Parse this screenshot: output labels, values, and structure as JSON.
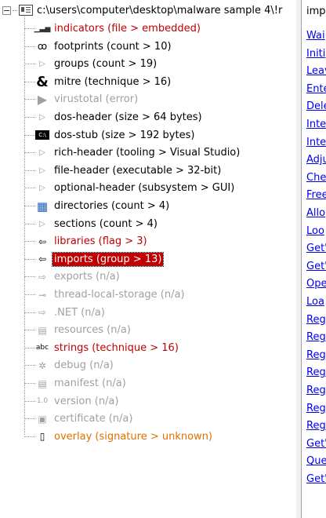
{
  "tree": {
    "root_label": "c:\\users\\computer\\desktop\\malware sample 4\\!r",
    "items": [
      {
        "label": "indicators (file > embedded)",
        "icon": "bar-chart-icon",
        "glyph": "▁▃▅",
        "color": "red"
      },
      {
        "label": "footprints (count > 10)",
        "icon": "footprints-icon",
        "glyph": "ꝏ",
        "color": "black"
      },
      {
        "label": "groups (count > 19)",
        "icon": "expand-arrow-icon",
        "glyph": "▷",
        "color": "black"
      },
      {
        "label": "mitre (technique > 16)",
        "icon": "ampersand-icon",
        "glyph": "&",
        "color": "black"
      },
      {
        "label": "virustotal (error)",
        "icon": "virustotal-icon",
        "glyph": "▶",
        "color": "gray"
      },
      {
        "label": "dos-header (size > 64 bytes)",
        "icon": "expand-arrow-icon",
        "glyph": "▷",
        "color": "black"
      },
      {
        "label": "dos-stub (size > 192 bytes)",
        "icon": "console-icon",
        "glyph": "C:\\",
        "color": "black"
      },
      {
        "label": "rich-header (tooling > Visual Studio)",
        "icon": "expand-arrow-icon",
        "glyph": "▷",
        "color": "black"
      },
      {
        "label": "file-header (executable > 32-bit)",
        "icon": "expand-arrow-icon",
        "glyph": "▷",
        "color": "black"
      },
      {
        "label": "optional-header (subsystem > GUI)",
        "icon": "expand-arrow-icon",
        "glyph": "▷",
        "color": "black"
      },
      {
        "label": "directories (count > 4)",
        "icon": "directories-icon",
        "glyph": "▦",
        "color": "black"
      },
      {
        "label": "sections (count > 4)",
        "icon": "expand-arrow-icon",
        "glyph": "▷",
        "color": "black"
      },
      {
        "label": "libraries (flag > 3)",
        "icon": "libraries-icon",
        "glyph": "⇦",
        "color": "red"
      },
      {
        "label": "imports (group > 13)",
        "icon": "imports-icon",
        "glyph": "⇦",
        "color": "red"
      },
      {
        "label": "exports (n/a)",
        "icon": "exports-icon",
        "glyph": "⇨",
        "color": "gray"
      },
      {
        "label": "thread-local-storage (n/a)",
        "icon": "tls-icon",
        "glyph": "⊸",
        "color": "gray"
      },
      {
        "label": ".NET (n/a)",
        "icon": "dotnet-icon",
        "glyph": "⇨",
        "color": "gray"
      },
      {
        "label": "resources (n/a)",
        "icon": "resources-icon",
        "glyph": "▤",
        "color": "gray"
      },
      {
        "label": "strings (technique > 16)",
        "icon": "strings-icon",
        "glyph": "abc",
        "color": "red"
      },
      {
        "label": "debug (n/a)",
        "icon": "bug-icon",
        "glyph": "✲",
        "color": "gray"
      },
      {
        "label": "manifest (n/a)",
        "icon": "manifest-icon",
        "glyph": "▤",
        "color": "gray"
      },
      {
        "label": "version (n/a)",
        "icon": "version-icon",
        "glyph": "1.0",
        "color": "gray"
      },
      {
        "label": "certificate (n/a)",
        "icon": "certificate-icon",
        "glyph": "▣",
        "color": "gray"
      },
      {
        "label": "overlay (signature > unknown)",
        "icon": "document-icon",
        "glyph": "▯",
        "color": "orange"
      }
    ],
    "selected_index": 13
  },
  "right_panel": {
    "header": "imp",
    "items": [
      "Wai",
      "Initi",
      "Leav",
      "Ente",
      "Dele",
      "Inte",
      "Inte",
      "Adju",
      "Che",
      "Free",
      "Allo",
      "Loo",
      "Get'",
      "Get'",
      "Ope",
      "Loa",
      "Reg",
      "Reg",
      "Reg",
      "Reg",
      "Reg",
      "Reg",
      "Reg",
      "Get'",
      "Que",
      "Get'"
    ]
  },
  "colors": {
    "red": "#c00000",
    "gray": "#a0a0a0",
    "orange": "#e07000",
    "link": "#0000ee",
    "selection": "#c00000"
  }
}
